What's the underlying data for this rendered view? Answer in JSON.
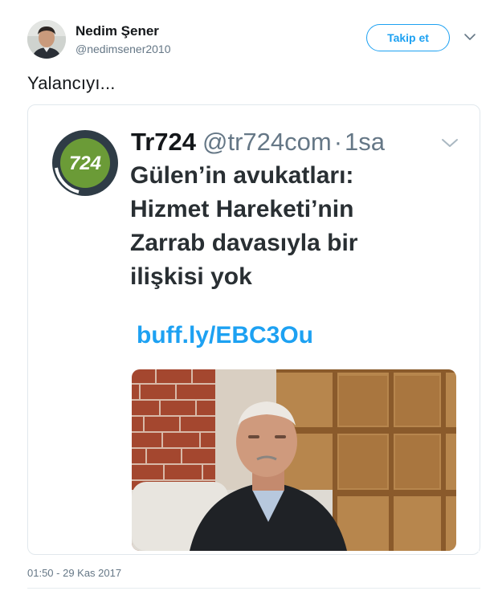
{
  "author": {
    "name": "Nedim Şener",
    "handle": "@nedimsener2010"
  },
  "follow_button": {
    "label": "Takip et"
  },
  "tweet": {
    "text": "Yalancıyı..."
  },
  "quoted_tweet": {
    "logo_text": "724",
    "name": "Tr724",
    "handle": "@tr724com",
    "separator": "·",
    "time": "1sa",
    "text_lines": [
      "Gülen’in avukatları:",
      "Hizmet Hareketi’nin",
      "Zarrab davasıyla bir",
      "ilişkisi yok"
    ],
    "link": "buff.ly/EBC3Ou"
  },
  "timestamp": "01:50 - 29 Kas 2017",
  "colors": {
    "accent": "#1da1f2",
    "secondary_text": "#657786",
    "logo_ring": "#2f3c46",
    "logo_fill": "#6b9b37"
  },
  "icons": {
    "tweet_menu": "chevron-down-icon",
    "quoted_menu": "chevron-down-icon"
  }
}
